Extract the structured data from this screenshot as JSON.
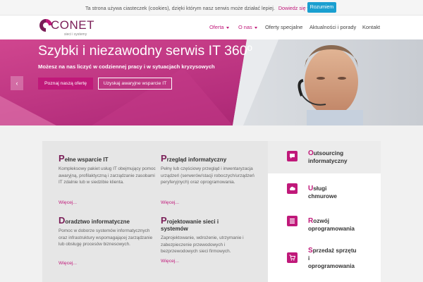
{
  "cookie_bar": {
    "text": "Ta strona używa ciasteczek (cookies), dzięki którym nasz serwis może działać lepiej.",
    "link": "Dowiedz się więcej",
    "button": "Rozumiem"
  },
  "header": {
    "logo_title": "CONET",
    "logo_sub": "sieci i systemy",
    "nav": [
      "Oferta",
      "O nas",
      "Oferty specjalne",
      "Aktualności i porady",
      "Kontakt"
    ]
  },
  "hero": {
    "title": "Szybki i niezawodny serwis IT 360º",
    "subtitle": "Możesz na nas liczyć w codziennej pracy i w sytuacjach kryzysowych",
    "btn_primary": "Poznaj naszą ofertę",
    "btn_secondary": "Uzyskaj awaryjne wsparcie IT",
    "arrow": "‹"
  },
  "features": [
    {
      "cap": "P",
      "title": "ełne wsparcie IT",
      "desc": "Kompleksowy pakiet usług IT obejmujący pomoc awaryjną, profilaktyczną i zarządzanie zasobami IT zdalnie lub w siedzibie klienta.",
      "more": "Więcej..."
    },
    {
      "cap": "P",
      "title": "rzegląd informatyczny",
      "desc": "Pełny lub częściowy przegląd i inwentaryzacja urządzeń (serwerów/stacji roboczych/urządzeń peryferyjnych) oraz oprogramowania.",
      "more": "Więcej..."
    },
    {
      "cap": "D",
      "title": "oradztwo informatyczne",
      "desc": "Pomoc w doborze systemów informatycznych oraz infrastruktury wspomagającej zarządzanie lub obsługę procesów biznesowych.",
      "more": "Więcej..."
    },
    {
      "cap": "P",
      "title": "rojektowanie sieci i systemów",
      "desc": "Zaprojektowanie, wdrożenie, utrzymanie i zabezpieczenie przewodowych i bezprzewodowych sieci firmowych.",
      "more": "Więcej..."
    }
  ],
  "sidebar": [
    {
      "cap": "O",
      "line1": "utsourcing",
      "line2": "informatyczny",
      "icon": "chat-icon"
    },
    {
      "cap": "U",
      "line1": "sługi",
      "line2": "chmurowe",
      "icon": "cloud-icon"
    },
    {
      "cap": "R",
      "line1": "ozwój",
      "line2": "oprogramowania",
      "icon": "list-icon"
    },
    {
      "cap": "S",
      "line1": "przedaż sprzętu",
      "line2": "i oprogramowania",
      "icon": "cart-icon"
    }
  ],
  "colors": {
    "accent": "#c0197a",
    "brand_dark": "#7a1d57",
    "cookie_button": "#1a9fd0"
  }
}
